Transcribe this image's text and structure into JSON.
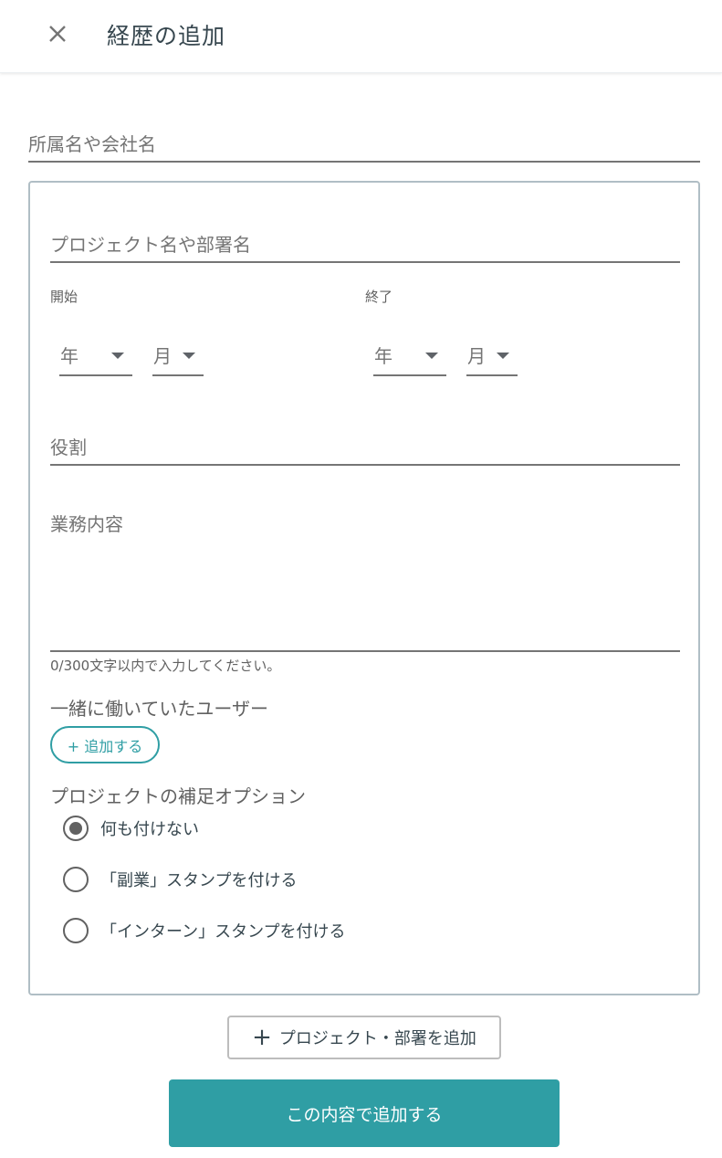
{
  "header": {
    "title": "経歴の追加",
    "close_icon": "close-icon"
  },
  "company": {
    "placeholder": "所属名や会社名"
  },
  "project": {
    "name_placeholder": "プロジェクト名や部署名",
    "start_label": "開始",
    "end_label": "終了",
    "start_year": "年",
    "start_month": "月",
    "end_year": "年",
    "end_month": "月",
    "role_placeholder": "役割",
    "description_placeholder": "業務内容",
    "char_count": "0/300文字以内で入力してください。",
    "coworkers_label": "一緒に働いていたユーザー",
    "add_user_label": "+ 追加する",
    "options_label": "プロジェクトの補足オプション",
    "options": [
      {
        "label": "何も付けない",
        "checked": true
      },
      {
        "label": "「副業」スタンプを付ける",
        "checked": false
      },
      {
        "label": "「インターン」スタンプを付ける",
        "checked": false
      }
    ]
  },
  "add_project": {
    "icon": "plus-icon",
    "label": "プロジェクト・部署を追加"
  },
  "submit": {
    "label": "この内容で追加する"
  },
  "colors": {
    "accent": "#2f9ea4",
    "border": "#b0bec5",
    "text": "#37474f"
  }
}
